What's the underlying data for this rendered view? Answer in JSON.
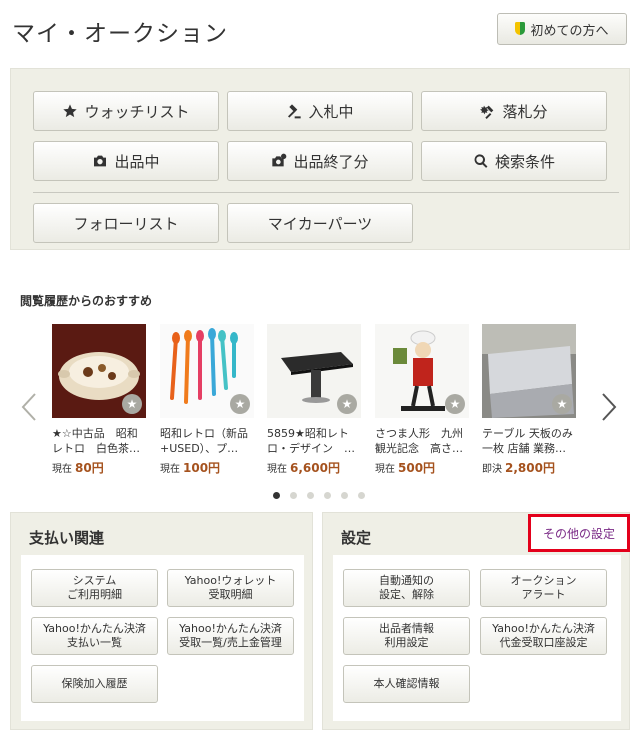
{
  "header": {
    "title": "マイ・オークション",
    "first_time_button": "初めての方へ",
    "first_time_icon": "beginner-leaf-icon"
  },
  "menu": {
    "watchlist": {
      "label": "ウォッチリスト",
      "icon": "star-icon"
    },
    "bidding": {
      "label": "入札中",
      "icon": "gavel-icon"
    },
    "won": {
      "label": "落札分",
      "icon": "gavel-burst-icon"
    },
    "selling": {
      "label": "出品中",
      "icon": "camera-icon"
    },
    "ended": {
      "label": "出品終了分",
      "icon": "camera-check-icon"
    },
    "saved_search": {
      "label": "検索条件",
      "icon": "search-icon"
    },
    "follow_list": {
      "label": "フォローリスト"
    },
    "my_car_parts": {
      "label": "マイカーパーツ"
    }
  },
  "recommend": {
    "title": "閲覧履歴からのおすすめ",
    "items": [
      {
        "title": "★☆中古品　昭和\nレトロ　白色茶…",
        "price_label": "現在",
        "price": "80円"
      },
      {
        "title": "昭和レトロ（新品\n+USED）、プ…",
        "price_label": "現在",
        "price": "100円"
      },
      {
        "title": "5859★昭和レト\nロ・デザイン　…",
        "price_label": "現在",
        "price": "6,600円"
      },
      {
        "title": "さつま人形　九州\n観光記念　高さ…",
        "price_label": "現在",
        "price": "500円"
      },
      {
        "title": "テーブル 天板のみ\n一枚 店舗 業務…",
        "price_label": "即決",
        "price": "2,800円"
      }
    ],
    "page_count": 6,
    "current_page": 1
  },
  "payment": {
    "title": "支払い関連",
    "buttons": [
      "システム\nご利用明細",
      "Yahoo!ウォレット\n受取明細",
      "Yahoo!かんたん決済\n支払い一覧",
      "Yahoo!かんたん決済\n受取一覧/売上金管理",
      "保険加入履歴"
    ]
  },
  "settings": {
    "title": "設定",
    "other_link": "その他の設定",
    "buttons": [
      "自動通知の\n設定、解除",
      "オークション\nアラート",
      "出品者情報\n利用設定",
      "Yahoo!かんたん決済\n代金受取口座設定",
      "本人確認情報"
    ]
  },
  "colors": {
    "panel_bg": "#efefe6",
    "price": "#a5521e",
    "highlight_border": "#e3001b",
    "link": "#7a2a86"
  }
}
